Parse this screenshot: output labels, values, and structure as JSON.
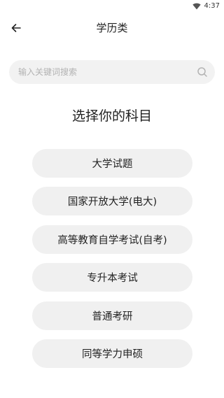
{
  "status_bar": {
    "time": "4:37",
    "icons": [
      "wifi-icon"
    ]
  },
  "header": {
    "back_icon": "arrow-left-icon",
    "title": "学历类"
  },
  "search": {
    "placeholder": "输入关键词搜索",
    "value": "",
    "icon": "search-icon"
  },
  "main": {
    "heading": "选择你的科目",
    "options": [
      {
        "label": "大学试题"
      },
      {
        "label": "国家开放大学(电大)"
      },
      {
        "label": "高等教育自学考试(自考)"
      },
      {
        "label": "专升本考试"
      },
      {
        "label": "普通考研"
      },
      {
        "label": "同等学力申硕"
      }
    ]
  },
  "colors": {
    "background": "#ffffff",
    "search_bg": "#f2f2f2",
    "option_bg": "#f0f0f0",
    "text": "#222222",
    "placeholder": "#b3b3b3"
  }
}
